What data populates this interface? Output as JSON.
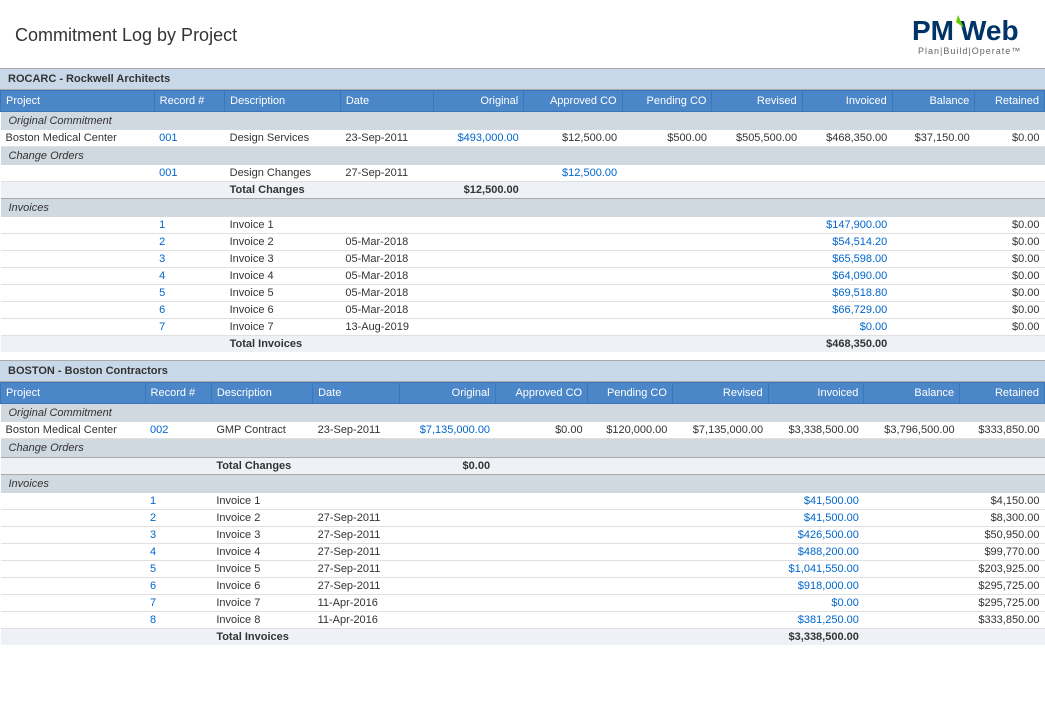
{
  "header": {
    "title": "Commitment Log by Project"
  },
  "logo": {
    "text": "PMWeb",
    "tagline": "Plan|Build|Operate™"
  },
  "sections": [
    {
      "id": "rocarc",
      "header": "ROCARC - Rockwell Architects",
      "columns": [
        "Project",
        "Record #",
        "Description",
        "Date",
        "Original",
        "Approved CO",
        "Pending CO",
        "Revised",
        "Invoiced",
        "Balance",
        "Retained"
      ],
      "original_commitment_label": "Original Commitment",
      "original_rows": [
        {
          "project": "Boston Medical Center",
          "record": "001",
          "description": "Design Services",
          "date": "23-Sep-2011",
          "original": "$493,000.00",
          "approved_co": "$12,500.00",
          "pending_co": "$500.00",
          "revised": "$505,500.00",
          "invoiced": "$468,350.00",
          "balance": "$37,150.00",
          "retained": "$0.00"
        }
      ],
      "change_orders_label": "Change Orders",
      "change_order_rows": [
        {
          "project": "",
          "record": "001",
          "description": "Design Changes",
          "date": "27-Sep-2011",
          "original": "",
          "approved_co": "$12,500.00",
          "pending_co": "",
          "revised": "",
          "invoiced": "",
          "balance": "",
          "retained": ""
        }
      ],
      "total_changes_label": "Total Changes",
      "total_changes_value": "$12,500.00",
      "invoices_label": "Invoices",
      "invoice_rows": [
        {
          "record": "1",
          "description": "Invoice 1",
          "date": "",
          "invoiced": "$147,900.00",
          "retained": "$0.00"
        },
        {
          "record": "2",
          "description": "Invoice 2",
          "date": "05-Mar-2018",
          "invoiced": "$54,514.20",
          "retained": "$0.00"
        },
        {
          "record": "3",
          "description": "Invoice 3",
          "date": "05-Mar-2018",
          "invoiced": "$65,598.00",
          "retained": "$0.00"
        },
        {
          "record": "4",
          "description": "Invoice 4",
          "date": "05-Mar-2018",
          "invoiced": "$64,090.00",
          "retained": "$0.00"
        },
        {
          "record": "5",
          "description": "Invoice 5",
          "date": "05-Mar-2018",
          "invoiced": "$69,518.80",
          "retained": "$0.00"
        },
        {
          "record": "6",
          "description": "Invoice 6",
          "date": "05-Mar-2018",
          "invoiced": "$66,729.00",
          "retained": "$0.00"
        },
        {
          "record": "7",
          "description": "Invoice 7",
          "date": "13-Aug-2019",
          "invoiced": "$0.00",
          "retained": "$0.00"
        }
      ],
      "total_invoices_label": "Total Invoices",
      "total_invoices_value": "$468,350.00"
    },
    {
      "id": "boston",
      "header": "BOSTON - Boston Contractors",
      "columns": [
        "Project",
        "Record #",
        "Description",
        "Date",
        "Original",
        "Approved CO",
        "Pending CO",
        "Revised",
        "Invoiced",
        "Balance",
        "Retained"
      ],
      "original_commitment_label": "Original Commitment",
      "original_rows": [
        {
          "project": "Boston Medical Center",
          "record": "002",
          "description": "GMP Contract",
          "date": "23-Sep-2011",
          "original": "$7,135,000.00",
          "approved_co": "$0.00",
          "pending_co": "$120,000.00",
          "revised": "$7,135,000.00",
          "invoiced": "$3,338,500.00",
          "balance": "$3,796,500.00",
          "retained": "$333,850.00"
        }
      ],
      "change_orders_label": "Change Orders",
      "change_order_rows": [],
      "total_changes_label": "Total Changes",
      "total_changes_value": "$0.00",
      "invoices_label": "Invoices",
      "invoice_rows": [
        {
          "record": "1",
          "description": "Invoice 1",
          "date": "",
          "invoiced": "$41,500.00",
          "retained": "$4,150.00"
        },
        {
          "record": "2",
          "description": "Invoice 2",
          "date": "27-Sep-2011",
          "invoiced": "$41,500.00",
          "retained": "$8,300.00"
        },
        {
          "record": "3",
          "description": "Invoice 3",
          "date": "27-Sep-2011",
          "invoiced": "$426,500.00",
          "retained": "$50,950.00"
        },
        {
          "record": "4",
          "description": "Invoice 4",
          "date": "27-Sep-2011",
          "invoiced": "$488,200.00",
          "retained": "$99,770.00"
        },
        {
          "record": "5",
          "description": "Invoice 5",
          "date": "27-Sep-2011",
          "invoiced": "$1,041,550.00",
          "retained": "$203,925.00"
        },
        {
          "record": "6",
          "description": "Invoice 6",
          "date": "27-Sep-2011",
          "invoiced": "$918,000.00",
          "retained": "$295,725.00"
        },
        {
          "record": "7",
          "description": "Invoice 7",
          "date": "11-Apr-2016",
          "invoiced": "$0.00",
          "retained": "$295,725.00"
        },
        {
          "record": "8",
          "description": "Invoice 8",
          "date": "11-Apr-2016",
          "invoiced": "$381,250.00",
          "retained": "$333,850.00"
        }
      ],
      "total_invoices_label": "Total Invoices",
      "total_invoices_value": "$3,338,500.00"
    }
  ]
}
